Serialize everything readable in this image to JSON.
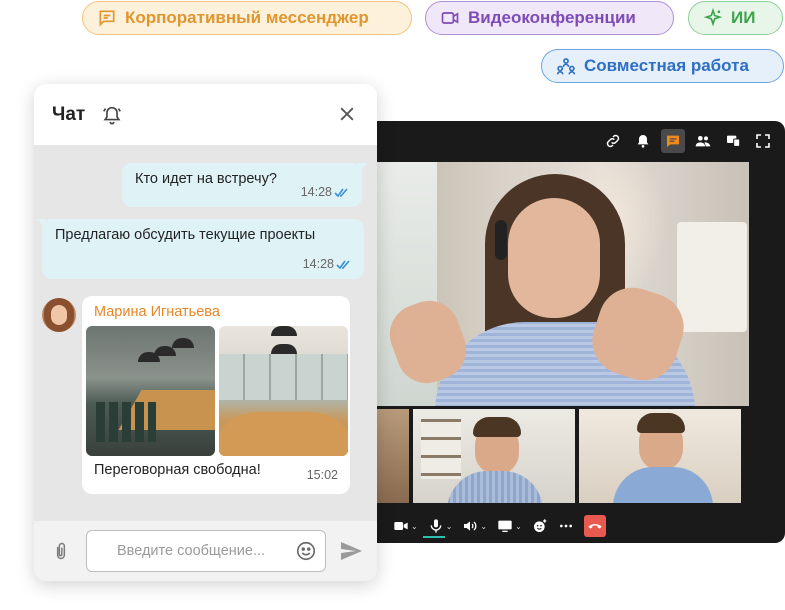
{
  "features": {
    "messenger": "Корпоративный мессенджер",
    "video": "Видеоконференции",
    "ai": "ИИ",
    "collab": "Совместная работа"
  },
  "colors": {
    "messenger": "#e0962e",
    "video": "#7e4bb7",
    "ai": "#3ea54d",
    "collab": "#2f6fc4",
    "active_tool": "#f08a1d",
    "hangup": "#e85a4f",
    "sender_name": "#e6862a",
    "read_ticks": "#3a8fd6"
  },
  "video_toolbar": {
    "icons": [
      "link-icon",
      "bell-icon",
      "chat-icon",
      "participants-icon",
      "screen-share-icon",
      "fullscreen-icon"
    ],
    "active": "chat-icon"
  },
  "video_controls": {
    "icons": [
      "camera-icon",
      "microphone-icon",
      "speaker-icon",
      "screen-icon",
      "reaction-icon",
      "more-icon",
      "hangup-icon"
    ]
  },
  "chat": {
    "title": "Чат",
    "messages_out": [
      {
        "text": "Кто идет на встречу?",
        "time": "14:28"
      },
      {
        "text": "Предлагаю обсудить текущие проекты",
        "time": "14:28"
      }
    ],
    "message_in": {
      "sender": "Марина Игнатьева",
      "text": "Переговорная свободна!",
      "time": "15:02"
    },
    "composer": {
      "placeholder": "Введите сообщение..."
    }
  }
}
